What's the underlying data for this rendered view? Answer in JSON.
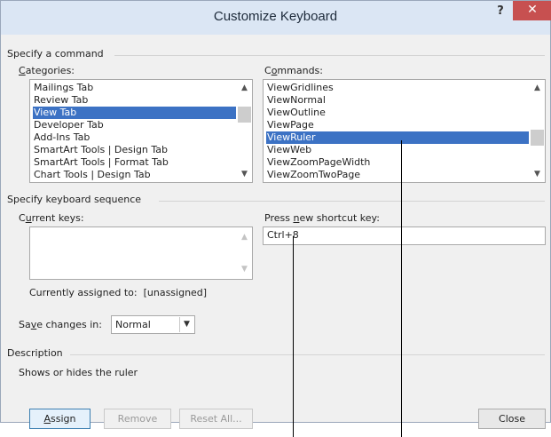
{
  "dialog": {
    "title": "Customize Keyboard",
    "help_label": "?",
    "close_glyph": "✕"
  },
  "specify_command": {
    "group_label": "Specify a command",
    "categories_label": "Categories:",
    "categories": [
      {
        "label": "Mailings Tab",
        "selected": false
      },
      {
        "label": "Review Tab",
        "selected": false
      },
      {
        "label": "View Tab",
        "selected": true
      },
      {
        "label": "Developer Tab",
        "selected": false
      },
      {
        "label": "Add-Ins Tab",
        "selected": false
      },
      {
        "label": "SmartArt Tools | Design Tab",
        "selected": false
      },
      {
        "label": "SmartArt Tools | Format Tab",
        "selected": false
      },
      {
        "label": "Chart Tools | Design Tab",
        "selected": false
      }
    ],
    "commands_label": "Commands:",
    "commands": [
      {
        "label": "ViewGridlines",
        "selected": false
      },
      {
        "label": "ViewNormal",
        "selected": false
      },
      {
        "label": "ViewOutline",
        "selected": false
      },
      {
        "label": "ViewPage",
        "selected": false
      },
      {
        "label": "ViewRuler",
        "selected": true
      },
      {
        "label": "ViewWeb",
        "selected": false
      },
      {
        "label": "ViewZoomPageWidth",
        "selected": false
      },
      {
        "label": "ViewZoomTwoPage",
        "selected": false
      }
    ]
  },
  "keyboard_sequence": {
    "group_label": "Specify keyboard sequence",
    "current_keys_label": "Current keys:",
    "press_new_label": "Press new shortcut key:",
    "new_shortcut_value": "Ctrl+8",
    "assigned_to_label": "Currently assigned to:",
    "assigned_to_value": "[unassigned]",
    "save_changes_label": "Save changes in:",
    "save_changes_value": "Normal"
  },
  "description": {
    "group_label": "Description",
    "text": "Shows or hides the ruler"
  },
  "buttons": {
    "assign": "Assign",
    "remove": "Remove",
    "reset_all": "Reset All...",
    "close": "Close"
  },
  "icons": {
    "scroll_up": "▲",
    "scroll_down": "▼",
    "dropdown": "▼"
  }
}
